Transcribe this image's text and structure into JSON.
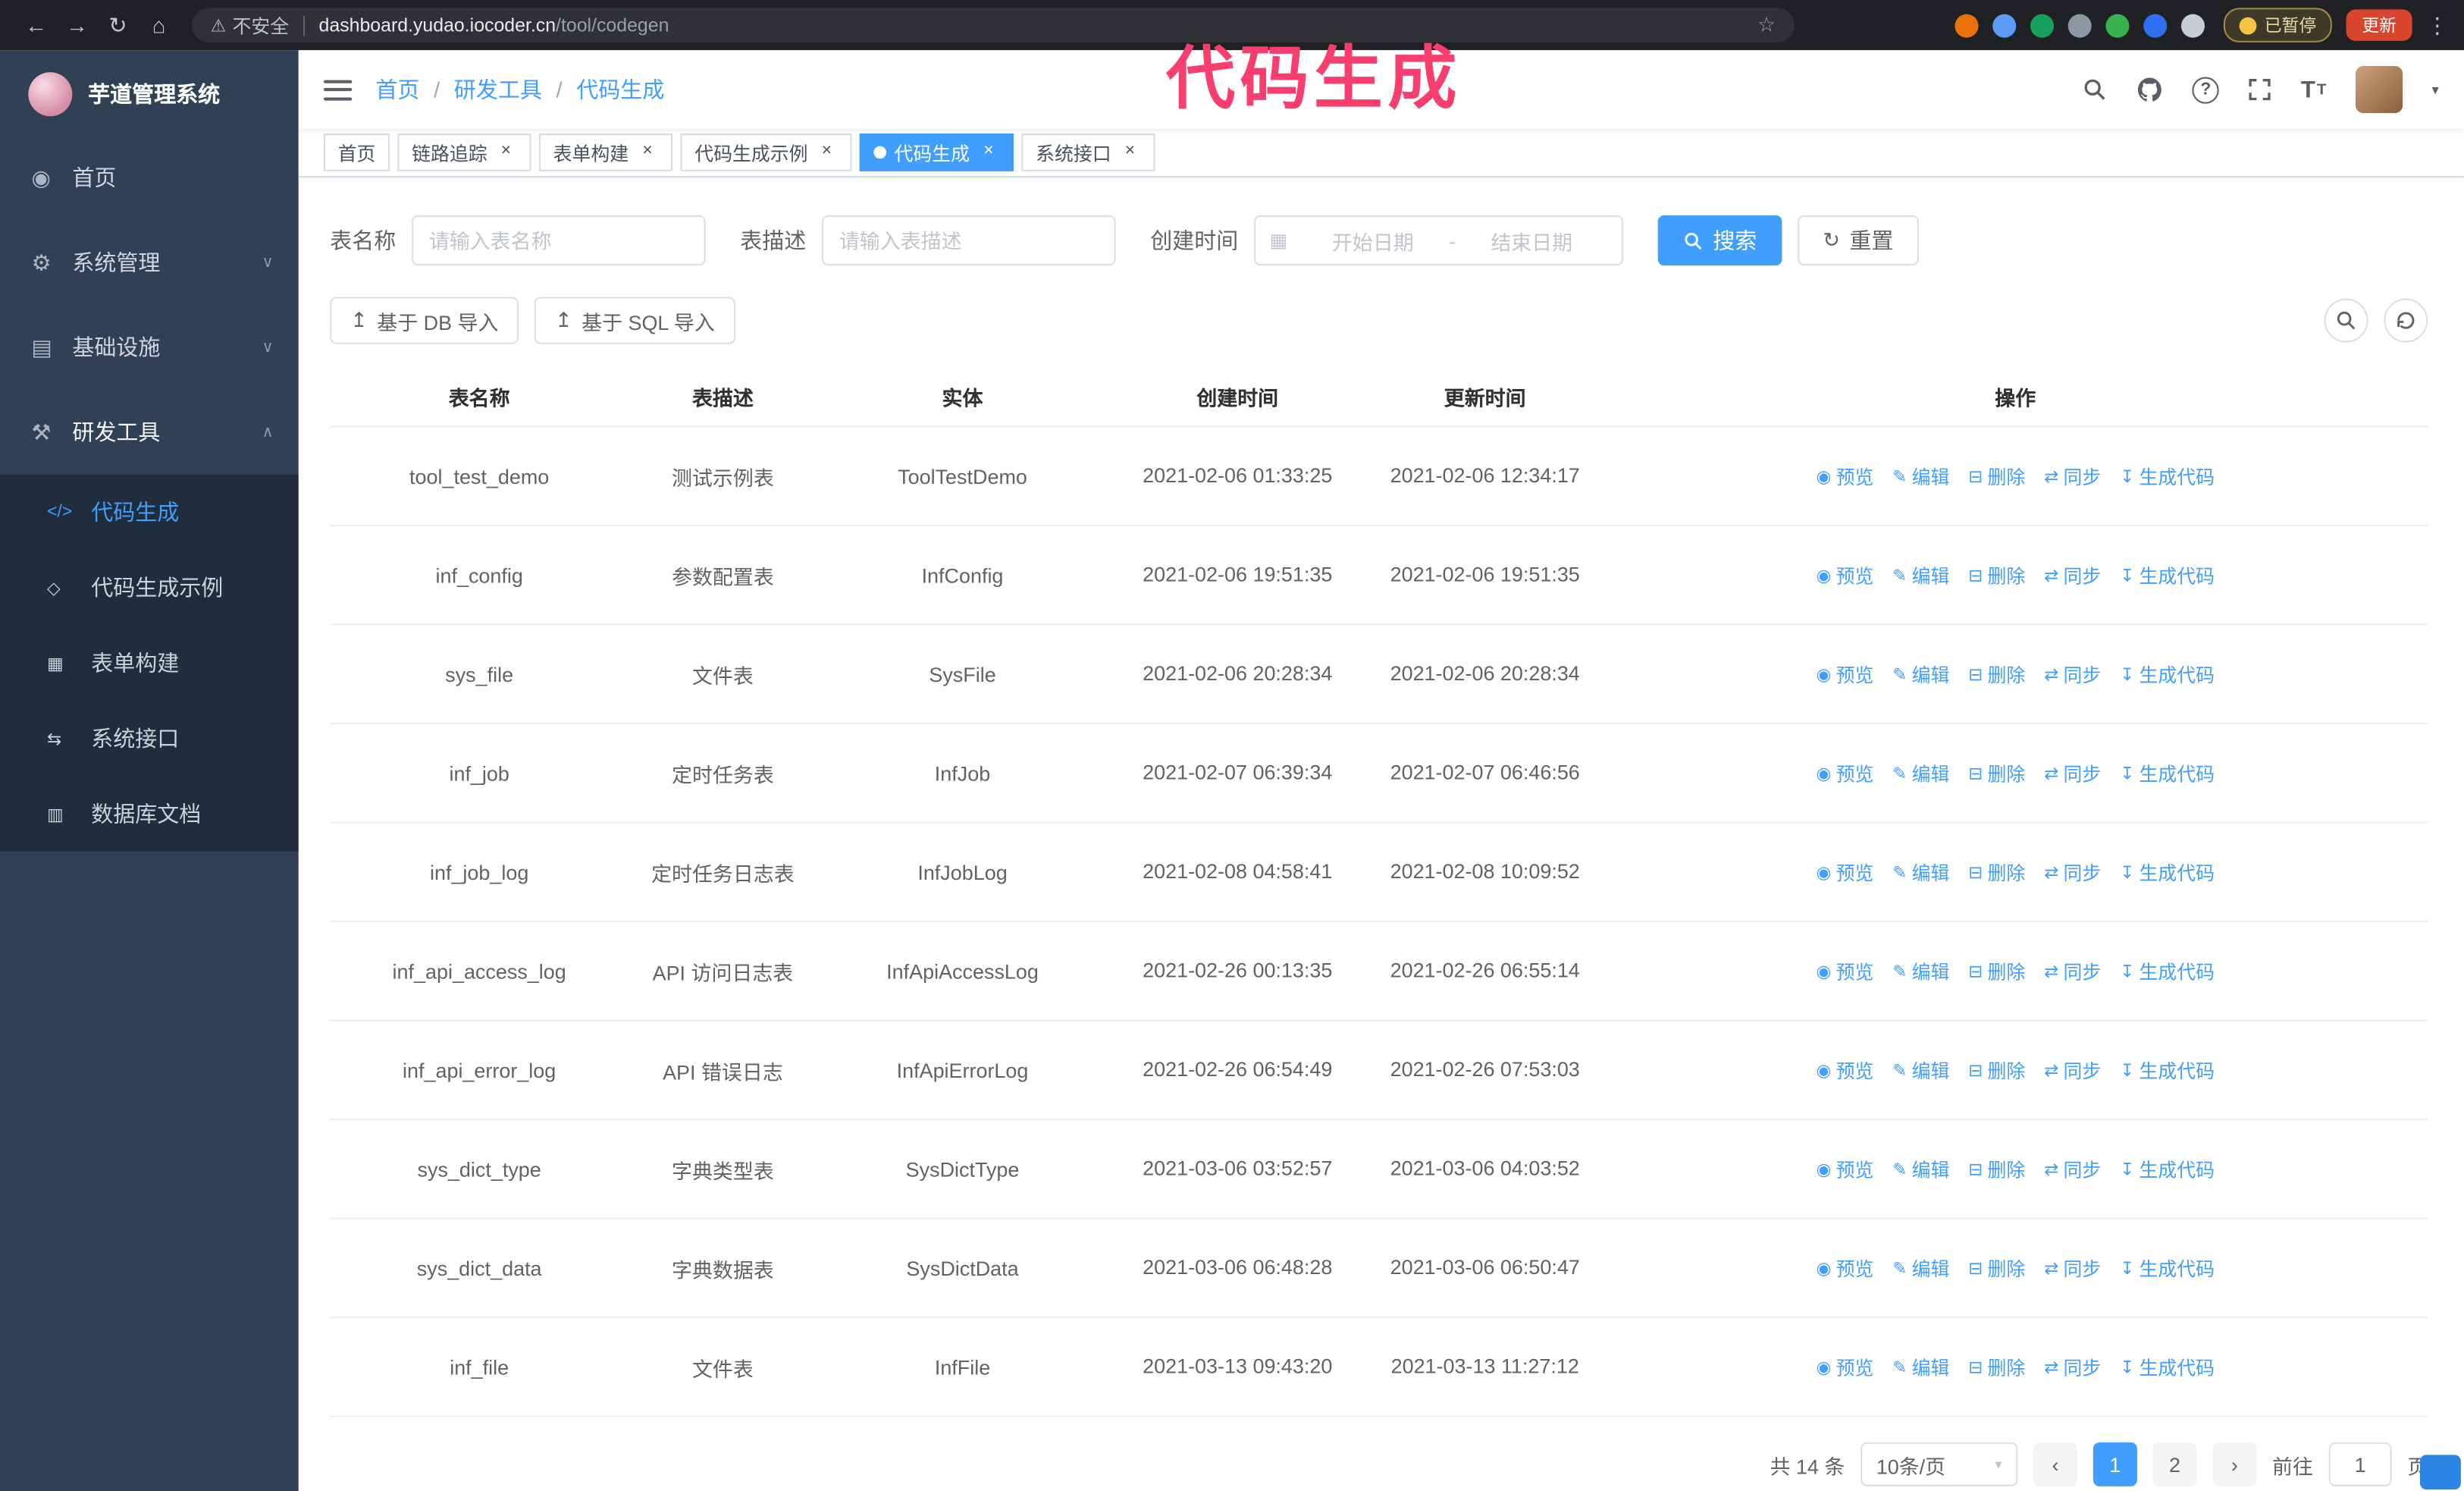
{
  "annotation": {
    "text": "代码生成"
  },
  "browser": {
    "nav_icons": [
      {
        "name": "back-icon",
        "glyph": "←"
      },
      {
        "name": "forward-icon",
        "glyph": "→"
      },
      {
        "name": "reload-icon",
        "glyph": "↻"
      },
      {
        "name": "home-icon",
        "glyph": "⌂"
      }
    ],
    "warning_icon": "⚠",
    "insecure_label": "不安全",
    "url_host": "dashboard.yudao.iocoder.cn",
    "url_path": "/tool/codegen",
    "star_icon": "☆",
    "extensions": [
      {
        "name": "extension-icon-1",
        "color": "#e8710a"
      },
      {
        "name": "extension-icon-2",
        "color": "#5b9bf8"
      },
      {
        "name": "extension-icon-3",
        "color": "#17a05d"
      },
      {
        "name": "extension-icon-4",
        "color": "#8e97a3"
      },
      {
        "name": "extension-icon-5",
        "color": "#37b24d"
      },
      {
        "name": "extension-icon-6",
        "color": "#2f6fed"
      },
      {
        "name": "extension-icon-7",
        "color": "#c9ccd1"
      }
    ],
    "paused_badge": "已暂停",
    "update_button": "更新",
    "kebab_icon": "⋮"
  },
  "sidebar": {
    "logo_title": "芋道管理系统",
    "items": [
      {
        "name": "sidebar-item-home",
        "icon_name": "home-icon",
        "icon": "◉",
        "label": "首页",
        "chevron": ""
      },
      {
        "name": "sidebar-item-system",
        "icon_name": "gear-icon",
        "icon": "⚙",
        "label": "系统管理",
        "chevron": "∨"
      },
      {
        "name": "sidebar-item-infrastructure",
        "icon_name": "monitor-icon",
        "icon": "▤",
        "label": "基础设施",
        "chevron": "∨"
      },
      {
        "name": "sidebar-item-devtools",
        "icon_name": "tools-icon",
        "icon": "⚒",
        "label": "研发工具",
        "chevron": "∧",
        "active": true
      }
    ],
    "submenu": [
      {
        "name": "sidebar-subitem-codegen",
        "icon_name": "code-icon",
        "icon": "</>",
        "label": "代码生成",
        "active": true
      },
      {
        "name": "sidebar-subitem-codegen-example",
        "icon_name": "demo-icon",
        "icon": "◇",
        "label": "代码生成示例"
      },
      {
        "name": "sidebar-subitem-form-builder",
        "icon_name": "form-icon",
        "icon": "▦",
        "label": "表单构建"
      },
      {
        "name": "sidebar-subitem-system-api",
        "icon_name": "api-icon",
        "icon": "⇆",
        "label": "系统接口"
      },
      {
        "name": "sidebar-subitem-db-doc",
        "icon_name": "database-icon",
        "icon": "▥",
        "label": "数据库文档"
      }
    ]
  },
  "header": {
    "breadcrumb": [
      "首页",
      "研发工具",
      "代码生成"
    ],
    "separator": "/",
    "help_icon": "?",
    "font_icon_large": "T",
    "font_icon_small": "T",
    "caret": "▾"
  },
  "tabs": [
    {
      "name": "tab-home",
      "label": "首页",
      "close": ""
    },
    {
      "name": "tab-tracing",
      "label": "链路追踪",
      "close": "×"
    },
    {
      "name": "tab-form-builder",
      "label": "表单构建",
      "close": "×"
    },
    {
      "name": "tab-codegen-example",
      "label": "代码生成示例",
      "close": "×"
    },
    {
      "name": "tab-codegen",
      "label": "代码生成",
      "close": "×",
      "active": true
    },
    {
      "name": "tab-system-api",
      "label": "系统接口",
      "close": "×"
    }
  ],
  "filters": {
    "table_name_label": "表名称",
    "table_name_placeholder": "请输入表名称",
    "table_desc_label": "表描述",
    "table_desc_placeholder": "请输入表描述",
    "create_time_label": "创建时间",
    "calendar_icon": "▦",
    "date_start_placeholder": "开始日期",
    "date_separator": "-",
    "date_end_placeholder": "结束日期",
    "search_button": "搜索",
    "reset_button": "重置",
    "reset_icon": "↻"
  },
  "toolbar": {
    "import_db_button": "基于 DB 导入",
    "import_sql_button": "基于 SQL 导入",
    "import_icon": "↥"
  },
  "table": {
    "columns": [
      "表名称",
      "表描述",
      "实体",
      "创建时间",
      "更新时间",
      "操作"
    ],
    "actions": [
      {
        "icon": "◉",
        "label": "预览"
      },
      {
        "icon": "✎",
        "label": "编辑"
      },
      {
        "icon": "⊟",
        "label": "删除"
      },
      {
        "icon": "⇄",
        "label": "同步"
      },
      {
        "icon": "↧",
        "label": "生成代码"
      }
    ],
    "rows": [
      {
        "name": "tool_test_demo",
        "desc": "测试示例表",
        "entity": "ToolTestDemo",
        "created": "2021-02-06 01:33:25",
        "updated": "2021-02-06 12:34:17"
      },
      {
        "name": "inf_config",
        "desc": "参数配置表",
        "entity": "InfConfig",
        "created": "2021-02-06 19:51:35",
        "updated": "2021-02-06 19:51:35"
      },
      {
        "name": "sys_file",
        "desc": "文件表",
        "entity": "SysFile",
        "created": "2021-02-06 20:28:34",
        "updated": "2021-02-06 20:28:34"
      },
      {
        "name": "inf_job",
        "desc": "定时任务表",
        "entity": "InfJob",
        "created": "2021-02-07 06:39:34",
        "updated": "2021-02-07 06:46:56"
      },
      {
        "name": "inf_job_log",
        "desc": "定时任务日志表",
        "entity": "InfJobLog",
        "created": "2021-02-08 04:58:41",
        "updated": "2021-02-08 10:09:52"
      },
      {
        "name": "inf_api_access_log",
        "desc": "API 访问日志表",
        "entity": "InfApiAccessLog",
        "created": "2021-02-26 00:13:35",
        "updated": "2021-02-26 06:55:14"
      },
      {
        "name": "inf_api_error_log",
        "desc": "API 错误日志",
        "entity": "InfApiErrorLog",
        "created": "2021-02-26 06:54:49",
        "updated": "2021-02-26 07:53:03"
      },
      {
        "name": "sys_dict_type",
        "desc": "字典类型表",
        "entity": "SysDictType",
        "created": "2021-03-06 03:52:57",
        "updated": "2021-03-06 04:03:52"
      },
      {
        "name": "sys_dict_data",
        "desc": "字典数据表",
        "entity": "SysDictData",
        "created": "2021-03-06 06:48:28",
        "updated": "2021-03-06 06:50:47"
      },
      {
        "name": "inf_file",
        "desc": "文件表",
        "entity": "InfFile",
        "created": "2021-03-13 09:43:20",
        "updated": "2021-03-13 11:27:12"
      }
    ]
  },
  "pagination": {
    "total": "共 14 条",
    "page_size": "10条/页",
    "caret": "▾",
    "prev_icon": "‹",
    "next_icon": "›",
    "pages": [
      {
        "name": "page-button-1",
        "label": "1",
        "active": true
      },
      {
        "name": "page-button-2",
        "label": "2"
      }
    ],
    "goto_label": "前往",
    "goto_value": "1",
    "page_unit": "页"
  },
  "colors": {
    "accent": "#409eff",
    "sidebar_bg": "#304156",
    "submenu_bg": "#1f2d3d",
    "annotation_pink": "#f73e6e"
  }
}
